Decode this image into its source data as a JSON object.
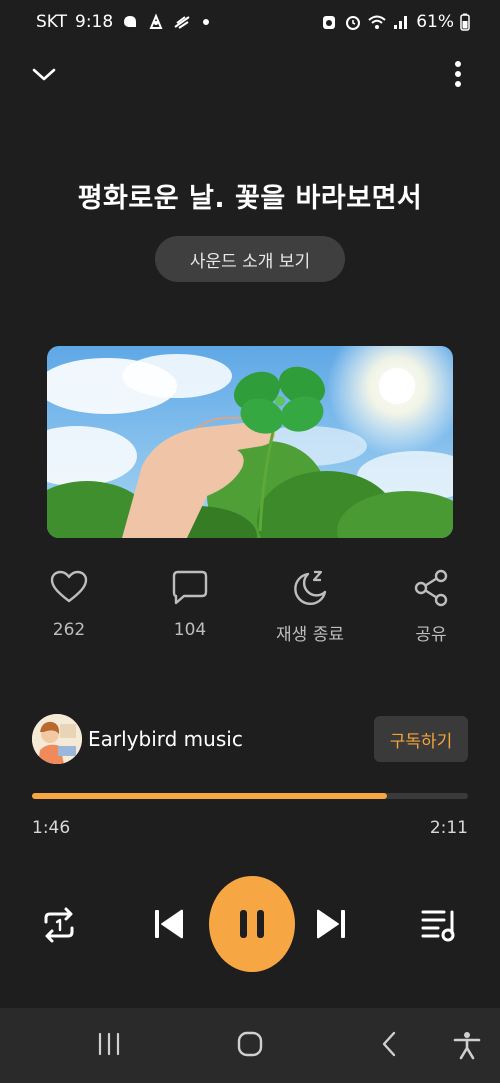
{
  "status_bar": {
    "carrier": "SKT",
    "time": "9:18",
    "battery": "61%"
  },
  "player": {
    "title": "평화로운 날. 꽃을 바라보면서",
    "intro_button": "사운드 소개 보기",
    "actions": [
      {
        "icon": "heart-icon",
        "label": "262"
      },
      {
        "icon": "comment-icon",
        "label": "104"
      },
      {
        "icon": "sleep-timer-icon",
        "label": "재생 종료"
      },
      {
        "icon": "share-icon",
        "label": "공유"
      }
    ],
    "channel": {
      "name": "Earlybird music",
      "subscribe_label": "구독하기"
    },
    "progress": {
      "current": "1:46",
      "total": "2:11",
      "fraction": 0.815
    }
  },
  "colors": {
    "accent": "#f6a743",
    "background": "#1e1e1e"
  }
}
